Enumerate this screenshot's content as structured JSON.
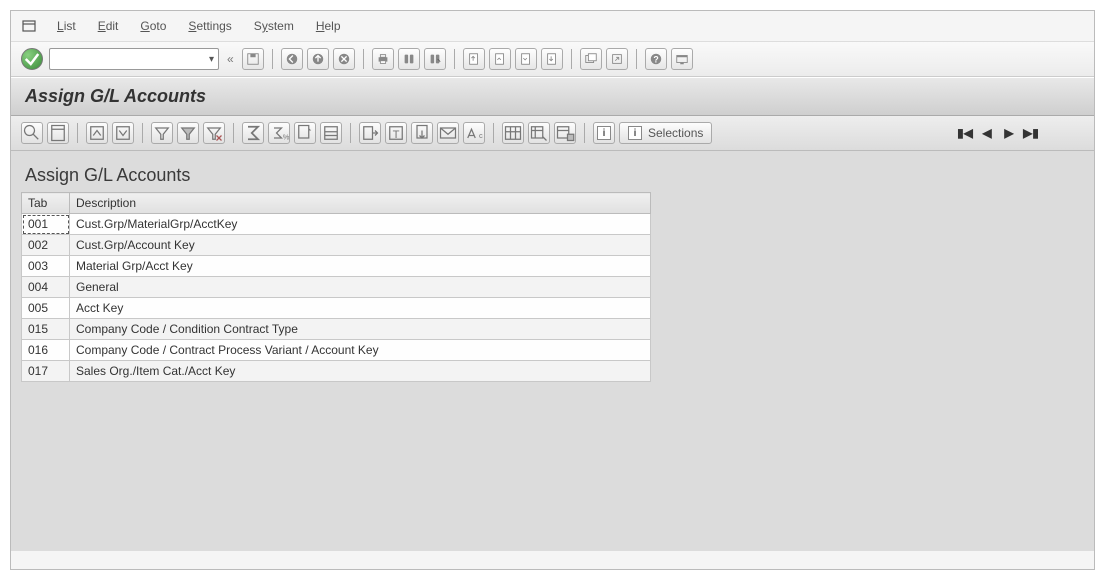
{
  "menu": {
    "items": [
      {
        "label": "List",
        "ul": "L"
      },
      {
        "label": "Edit",
        "ul": "E"
      },
      {
        "label": "Goto",
        "ul": "G"
      },
      {
        "label": "Settings",
        "ul": "S"
      },
      {
        "label": "System",
        "ul": "S"
      },
      {
        "label": "Help",
        "ul": "H"
      }
    ]
  },
  "title": "Assign G/L Accounts",
  "subtitle": "Assign G/L Accounts",
  "selectionsLabel": "Selections",
  "table": {
    "headers": {
      "tab": "Tab",
      "desc": "Description"
    },
    "rows": [
      {
        "tab": "001",
        "desc": "Cust.Grp/MaterialGrp/AcctKey"
      },
      {
        "tab": "002",
        "desc": "Cust.Grp/Account Key"
      },
      {
        "tab": "003",
        "desc": "Material Grp/Acct Key"
      },
      {
        "tab": "004",
        "desc": "General"
      },
      {
        "tab": "005",
        "desc": "Acct Key"
      },
      {
        "tab": "015",
        "desc": "Company Code / Condition Contract Type"
      },
      {
        "tab": "016",
        "desc": "Company Code / Contract Process Variant / Account Key"
      },
      {
        "tab": "017",
        "desc": "Sales Org./Item Cat./Acct Key"
      }
    ]
  }
}
